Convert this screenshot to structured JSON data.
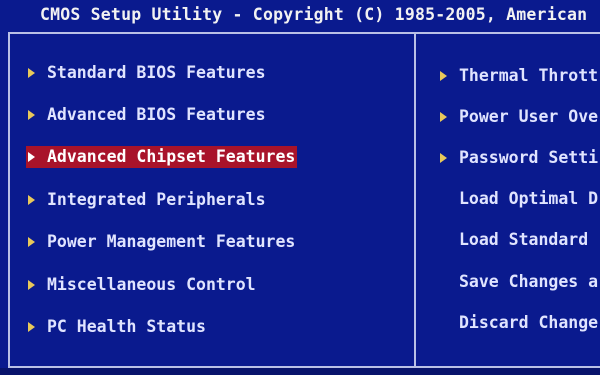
{
  "title": "CMOS Setup Utility - Copyright (C) 1985-2005, American",
  "colors": {
    "background": "#0a1a8e",
    "highlight": "#a8132a",
    "arrow": "#e8c85a",
    "text": "#e0e4ff"
  },
  "left_menu": {
    "items": [
      {
        "label": "Standard BIOS Features",
        "selected": false
      },
      {
        "label": "Advanced BIOS Features",
        "selected": false
      },
      {
        "label": "Advanced Chipset Features",
        "selected": true
      },
      {
        "label": "Integrated Peripherals",
        "selected": false
      },
      {
        "label": "Power Management Features",
        "selected": false
      },
      {
        "label": "Miscellaneous Control",
        "selected": false
      },
      {
        "label": "PC Health Status",
        "selected": false
      }
    ]
  },
  "right_menu": {
    "items": [
      {
        "label": "Thermal Thrott",
        "has_arrow": true
      },
      {
        "label": "Power User Ove",
        "has_arrow": true
      },
      {
        "label": "Password Setti",
        "has_arrow": true
      },
      {
        "label": "Load Optimal D",
        "has_arrow": false
      },
      {
        "label": "Load Standard",
        "has_arrow": false
      },
      {
        "label": "Save Changes a",
        "has_arrow": false
      },
      {
        "label": "Discard Change",
        "has_arrow": false
      }
    ]
  }
}
